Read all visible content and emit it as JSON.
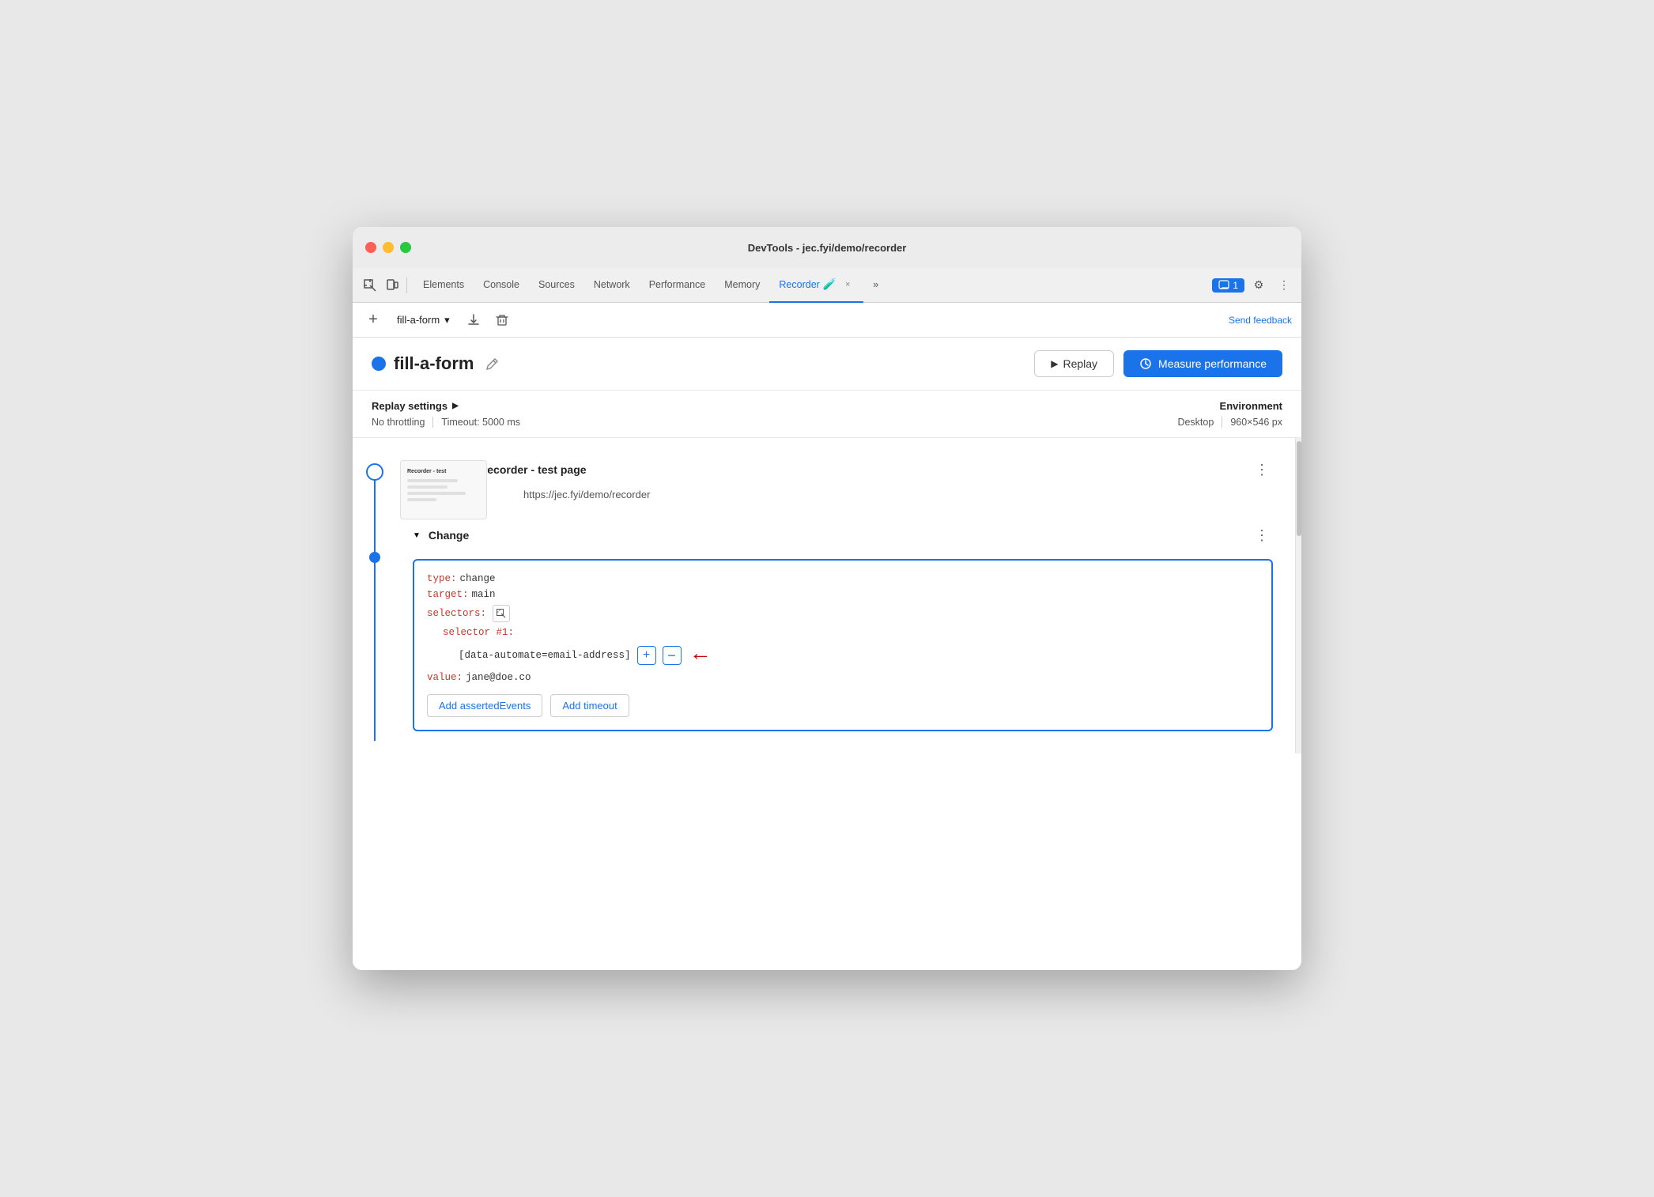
{
  "window": {
    "title": "DevTools - jec.fyi/demo/recorder"
  },
  "devtools_tabs": {
    "items": [
      {
        "label": "Elements",
        "active": false
      },
      {
        "label": "Console",
        "active": false
      },
      {
        "label": "Sources",
        "active": false
      },
      {
        "label": "Network",
        "active": false
      },
      {
        "label": "Performance",
        "active": false
      },
      {
        "label": "Memory",
        "active": false
      },
      {
        "label": "Recorder",
        "active": true
      }
    ],
    "more_tabs_label": "»",
    "chat_badge": "1",
    "settings_icon": "⚙",
    "more_options_icon": "⋮",
    "recorder_experiment_icon": "🧪",
    "recorder_close": "×"
  },
  "recorder_toolbar": {
    "add_btn_icon": "+",
    "recording_name": "fill-a-form",
    "dropdown_icon": "▾",
    "export_icon": "↓",
    "delete_icon": "🗑",
    "send_feedback_label": "Send feedback"
  },
  "recording_header": {
    "title": "fill-a-form",
    "edit_icon": "✏",
    "replay_label": "Replay",
    "replay_icon": "▶",
    "measure_label": "Measure performance",
    "measure_icon": "⟳"
  },
  "replay_settings": {
    "title": "Replay settings",
    "expand_icon": "▶",
    "throttling": "No throttling",
    "timeout": "Timeout: 5000 ms",
    "environment_title": "Environment",
    "device": "Desktop",
    "resolution": "960×546 px"
  },
  "step1": {
    "title": "Puppeteer recorder - test page",
    "url": "https://jec.fyi/demo/recorder",
    "more_icon": "⋮"
  },
  "step2": {
    "title": "Change",
    "more_icon": "⋮",
    "code": {
      "type_key": "type:",
      "type_value": "change",
      "target_key": "target:",
      "target_value": "main",
      "selectors_key": "selectors:",
      "selector_num_key": "selector #1:",
      "selector_value": "[data-automate=email-address]",
      "value_key": "value:",
      "value_value": "jane@doe.co"
    },
    "add_asserted_events_label": "Add assertedEvents",
    "add_timeout_label": "Add timeout"
  },
  "colors": {
    "accent_blue": "#1a73e8",
    "red_arrow": "#cc0000",
    "text_primary": "#222222",
    "text_secondary": "#555555",
    "border": "#e0e0e0"
  }
}
